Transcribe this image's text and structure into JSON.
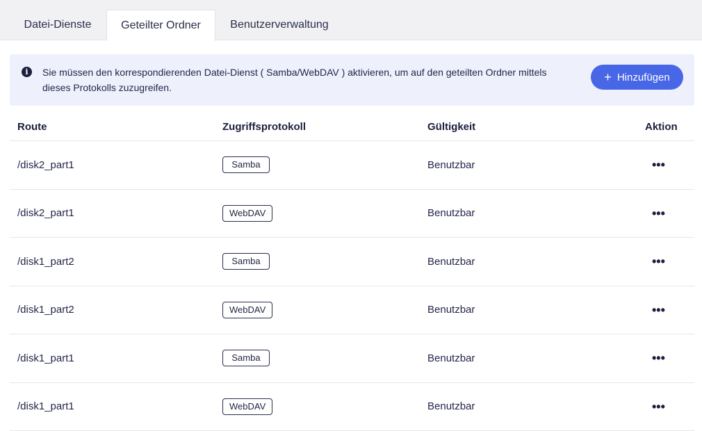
{
  "tabs": [
    {
      "label": "Datei-Dienste",
      "active": false
    },
    {
      "label": "Geteilter Ordner",
      "active": true
    },
    {
      "label": "Benutzerverwaltung",
      "active": false
    }
  ],
  "info": {
    "icon": "info-icon",
    "text": "Sie müssen den korrespondierenden Datei-Dienst ( Samba/WebDAV ) aktivieren, um auf den geteilten Ordner mittels dieses Protokolls zuzugreifen.",
    "add_button_label": "Hinzufügen",
    "add_button_icon": "+"
  },
  "table": {
    "headers": {
      "route": "Route",
      "protocol": "Zugriffsprotokoll",
      "validity": "Gültigkeit",
      "action": "Aktion"
    },
    "rows": [
      {
        "route": "/disk2_part1",
        "protocol": "Samba",
        "validity": "Benutzbar",
        "action": "•••"
      },
      {
        "route": "/disk2_part1",
        "protocol": "WebDAV",
        "validity": "Benutzbar",
        "action": "•••"
      },
      {
        "route": "/disk1_part2",
        "protocol": "Samba",
        "validity": "Benutzbar",
        "action": "•••"
      },
      {
        "route": "/disk1_part2",
        "protocol": "WebDAV",
        "validity": "Benutzbar",
        "action": "•••"
      },
      {
        "route": "/disk1_part1",
        "protocol": "Samba",
        "validity": "Benutzbar",
        "action": "•••"
      },
      {
        "route": "/disk1_part1",
        "protocol": "WebDAV",
        "validity": "Benutzbar",
        "action": "•••"
      }
    ]
  },
  "colors": {
    "accent": "#4867e6",
    "info_background": "#eef0fb",
    "tabbar_background": "#f1f1f4",
    "text": "#1f2340"
  }
}
